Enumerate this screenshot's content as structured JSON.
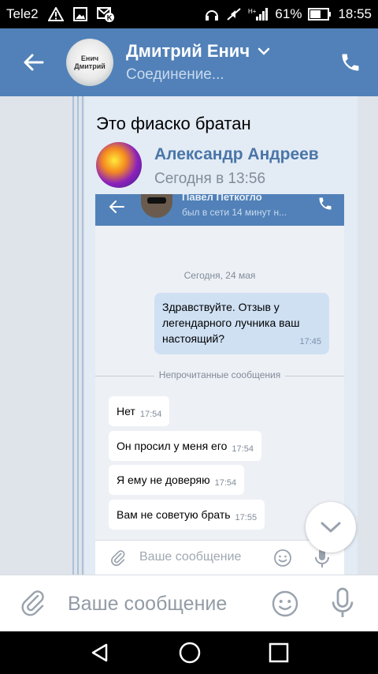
{
  "status_bar": {
    "carrier": "Tele2",
    "battery": "61%",
    "time": "18:55",
    "icons": [
      "warning-icon",
      "image-icon",
      "vk-notification-icon",
      "headphones-icon",
      "mute-icon",
      "signal-icon",
      "battery-icon"
    ]
  },
  "header": {
    "name": "Дмитрий Енич",
    "status": "Соединение...",
    "avatar_text": "Енич Дмитрий"
  },
  "message": {
    "text": "Это фиаско братан"
  },
  "forwarded": {
    "author": "Александр Андреев",
    "time": "Сегодня в 13:56"
  },
  "embedded": {
    "name": "Павел Петкогло",
    "status": "был в сети 14 минут н...",
    "date": "Сегодня, 24 мая",
    "outgoing": {
      "text": "Здравствуйте. Отзыв у легендарного лучника ваш настоящий?",
      "time": "17:45"
    },
    "unread_label": "Непрочитанные сообщения",
    "incoming": [
      {
        "text": "Нет",
        "time": "17:54"
      },
      {
        "text": "Он просил у меня его",
        "time": "17:54"
      },
      {
        "text": "Я ему не доверяю",
        "time": "17:54"
      },
      {
        "text": "Вам не советую брать",
        "time": "17:55"
      }
    ],
    "input_placeholder": "Ваше сообщение"
  },
  "input": {
    "placeholder": "Ваше сообщение"
  },
  "colors": {
    "header": "#5181b8",
    "accent": "#4a76a8",
    "background": "#dfe4ea"
  }
}
